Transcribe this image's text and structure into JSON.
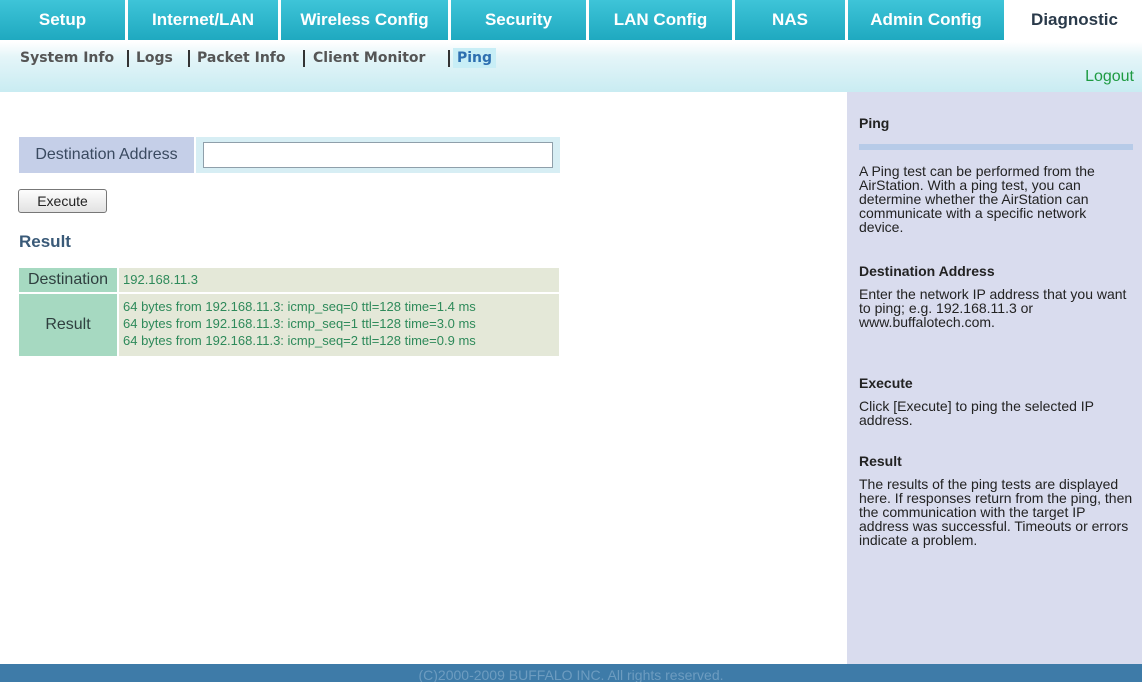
{
  "nav": {
    "tabs": [
      {
        "label": "Setup"
      },
      {
        "label": "Internet/LAN"
      },
      {
        "label": "Wireless Config"
      },
      {
        "label": "Security"
      },
      {
        "label": "LAN Config"
      },
      {
        "label": "NAS"
      },
      {
        "label": "Admin Config"
      },
      {
        "label": "Diagnostic",
        "active": true
      }
    ],
    "subtabs": [
      {
        "label": "System Info"
      },
      {
        "label": "Logs"
      },
      {
        "label": "Packet Info"
      },
      {
        "label": "Client Monitor"
      },
      {
        "label": "Ping",
        "active": true
      }
    ],
    "logout": "Logout"
  },
  "form": {
    "destination_label": "Destination Address",
    "destination_value": "",
    "execute_label": "Execute"
  },
  "result": {
    "heading": "Result",
    "destination_label": "Destination",
    "destination_value": "192.168.11.3",
    "result_label": "Result",
    "lines": [
      "64 bytes from 192.168.11.3: icmp_seq=0 ttl=128 time=1.4 ms",
      "64 bytes from 192.168.11.3: icmp_seq=1 ttl=128 time=3.0 ms",
      "64 bytes from 192.168.11.3: icmp_seq=2 ttl=128 time=0.9 ms"
    ]
  },
  "help": {
    "title": "Ping",
    "intro": "A Ping test can be performed from the AirStation. With a ping test, you can determine whether the AirStation can communicate with a specific network device.",
    "sections": [
      {
        "title": "Destination Address",
        "text": "Enter the network IP address that you want to ping; e.g. 192.168.11.3 or www.buffalotech.com."
      },
      {
        "title": "Execute",
        "text": "Click [Execute] to ping the selected IP address."
      },
      {
        "title": "Result",
        "text": "The results of the ping tests are displayed here. If responses return from the ping, then the communication with the target IP address was successful. Timeouts or errors indicate a problem."
      }
    ]
  },
  "footer": "(C)2000-2009 BUFFALO INC. All rights reserved.",
  "colors": {
    "tab_bg": "#1fa9c0",
    "accent_green": "#1e9b42",
    "help_bg": "#d9dcee",
    "footer_bg": "#3e7ba8"
  }
}
